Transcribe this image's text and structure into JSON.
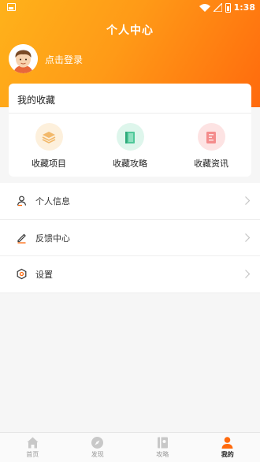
{
  "status_bar": {
    "time": "1:38"
  },
  "header": {
    "title": "个人中心",
    "login_text": "点击登录"
  },
  "collections": {
    "title": "我的收藏",
    "items": [
      {
        "label": "收藏项目",
        "icon": "layers-icon",
        "color": "#f2b96b"
      },
      {
        "label": "收藏攻略",
        "icon": "book-icon",
        "color": "#4fc89a"
      },
      {
        "label": "收藏资讯",
        "icon": "document-icon",
        "color": "#f48c8c"
      }
    ]
  },
  "menu": [
    {
      "label": "个人信息",
      "icon": "user-icon"
    },
    {
      "label": "反馈中心",
      "icon": "edit-icon"
    },
    {
      "label": "设置",
      "icon": "settings-icon"
    }
  ],
  "tabbar": {
    "active_color": "#ff6a0d",
    "items": [
      {
        "label": "首页",
        "icon": "home-icon",
        "active": false
      },
      {
        "label": "发现",
        "icon": "compass-icon",
        "active": false
      },
      {
        "label": "攻略",
        "icon": "guide-icon",
        "active": false
      },
      {
        "label": "我的",
        "icon": "profile-icon",
        "active": true
      }
    ]
  }
}
